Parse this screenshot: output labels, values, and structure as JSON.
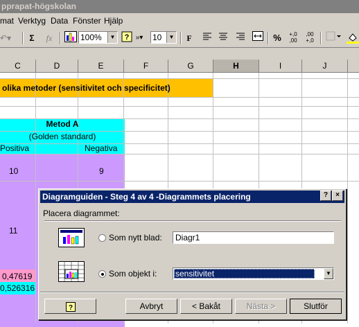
{
  "window": {
    "title": "pprapat-högskolan"
  },
  "menu": [
    "mat",
    "Verktyg",
    "Data",
    "Fönster",
    "Hjälp"
  ],
  "toolbar": {
    "zoom": "100%",
    "font_size": "10",
    "bold": "F",
    "percent": "%",
    "inc_decimal": "+,0\n,00",
    "dec_decimal": ",00\n+,0",
    "sum": "Σ",
    "fx": "fx"
  },
  "columns": [
    "C",
    "D",
    "E",
    "F",
    "G",
    "H",
    "I",
    "J"
  ],
  "sheet": {
    "header_text": "olika metoder (sensitivitet och specificitet)",
    "metod_title": "Metod A",
    "metod_sub": "(Golden standard)",
    "positiva": "Positiva",
    "negativa": "Negativa",
    "val_10": "10",
    "val_9": "9",
    "val_11": "11",
    "val_047619": "0,47619",
    "val_0526316": "0,526316"
  },
  "dialog": {
    "title": "Diagramguiden - Steg 4 av 4 -Diagrammets placering",
    "group_label": "Placera diagrammet:",
    "option_new_sheet": "Som nytt blad:",
    "option_object": "Som objekt i:",
    "new_sheet_value": "Diagr1",
    "object_value": "sensitivitet",
    "help_button": "?",
    "cancel_button": "Avbryt",
    "back_button": "< Bakåt",
    "next_button": "Nästa >",
    "finish_button": "Slutför",
    "title_help": "?",
    "title_close": "×"
  },
  "colors": {
    "orange": "#ffc000",
    "cyan": "#00ffff",
    "lavender": "#cc99ff",
    "pink": "#ff99cc",
    "dialog_title": "#0a246a"
  }
}
